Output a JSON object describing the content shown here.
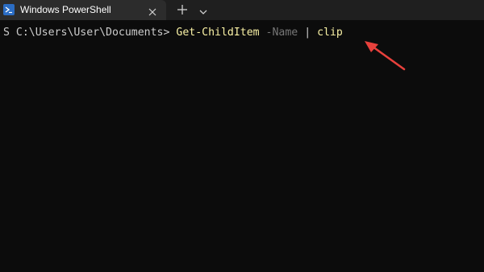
{
  "window": {
    "tab_title": "Windows PowerShell",
    "tab_icon": "powershell-icon",
    "close_icon": "close-icon",
    "new_tab_icon": "plus-icon",
    "dropdown_icon": "chevron-down-icon"
  },
  "terminal": {
    "prompt": "S C:\\Users\\User\\Documents> ",
    "command": "Get-ChildItem",
    "space1": " ",
    "param": "-Name",
    "pipe": " | ",
    "pipe_target": "clip"
  },
  "colors": {
    "background": "#0c0c0c",
    "titlebar": "#1f1f1f",
    "tab": "#2c2c2c",
    "command": "#f9f1a5",
    "parameter": "#767676",
    "text": "#cccccc",
    "annotation_arrow": "#e8413c"
  }
}
